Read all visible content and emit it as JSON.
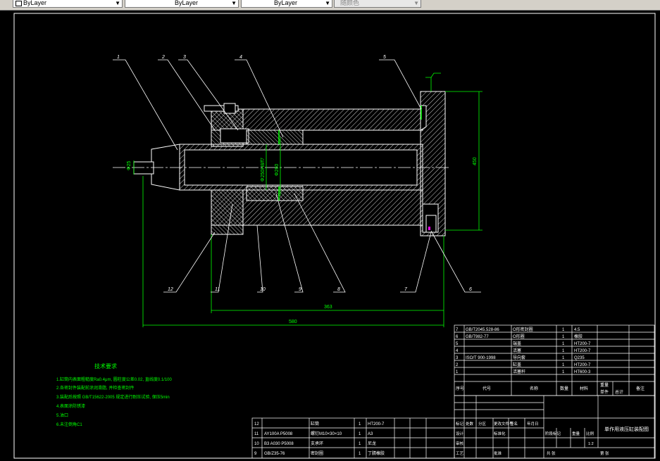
{
  "toolbar": {
    "color_control": "ByLayer",
    "linetype_control": "ByLayer",
    "lineweight_control": "ByLayer",
    "plotstyle_control": "随颜色"
  },
  "drawing": {
    "part_labels": [
      "1",
      "2",
      "3",
      "4",
      "5",
      "6",
      "7",
      "8",
      "9",
      "10",
      "11",
      "12"
    ],
    "dims": {
      "d1": "Φ25",
      "d2": "Φ250H8/f7",
      "d3": "Φ260",
      "d4": "450",
      "len_inner": "363",
      "len_total": "580"
    },
    "tech_req": {
      "title": "技术要求",
      "lines": [
        "1.缸筒内表面粗糙度Ra0.4μm, 圆柱度公差0.02, 直线度0.1/100",
        "2.各密封件装配前涂润滑脂, 并检查密封件",
        "3.装配后按照 GB/T15622-2005 规定进行耐压试验, 保压5min",
        "4.表面涂防锈漆",
        "5.油口",
        "6.未注倒角C1"
      ]
    },
    "bom_upper": [
      {
        "no": "7",
        "code": "GB/T2045.528-86",
        "name": "O形密封圈",
        "qty": "1",
        "mat": "4.5"
      },
      {
        "no": "6",
        "code": "GB/T982-77",
        "name": "O形圈",
        "qty": "1",
        "mat": "橡胶"
      },
      {
        "no": "5",
        "code": "",
        "name": "端盖",
        "qty": "1",
        "mat": "HT200-7"
      },
      {
        "no": "4",
        "code": "",
        "name": "活塞",
        "qty": "1",
        "mat": "HT200-7"
      },
      {
        "no": "3",
        "code": "ISO/T 900-1998",
        "name": "导向套",
        "qty": "1",
        "mat": "Q235"
      },
      {
        "no": "2",
        "code": "",
        "name": "缸盖",
        "qty": "1",
        "mat": "HT200-7"
      },
      {
        "no": "1",
        "code": "",
        "name": "活塞杆",
        "qty": "1",
        "mat": "HT600-3"
      }
    ],
    "bom_header": [
      "序号",
      "代号",
      "名称",
      "数量",
      "材料",
      "单件",
      "总计",
      "备注"
    ],
    "bom_header_weight": "重量",
    "bom_lower": [
      {
        "no": "12",
        "code": "",
        "name": "缸筒",
        "qty": "1",
        "mat": "HT200-7"
      },
      {
        "no": "11",
        "code": "AY100A P5008",
        "name": "螺钉M10×30×10",
        "qty": "1",
        "mat": "A3"
      },
      {
        "no": "10",
        "code": "B3 A030 P5008",
        "name": "支承环",
        "qty": "1",
        "mat": "尼龙"
      },
      {
        "no": "9",
        "code": "GB/Z35-76",
        "name": "密封圈",
        "qty": "1",
        "mat": "丁腈橡胶"
      }
    ],
    "title_block": {
      "drawing_name": "单作用液压缸装配图",
      "scale": "1:2",
      "labels": [
        "标记",
        "处数",
        "分区",
        "更改文件号",
        "签名",
        "年月日",
        "设计",
        "标准化",
        "阶段标记",
        "重量",
        "比例",
        "审核",
        "工艺",
        "批准",
        "共  张",
        "第  张"
      ]
    }
  }
}
